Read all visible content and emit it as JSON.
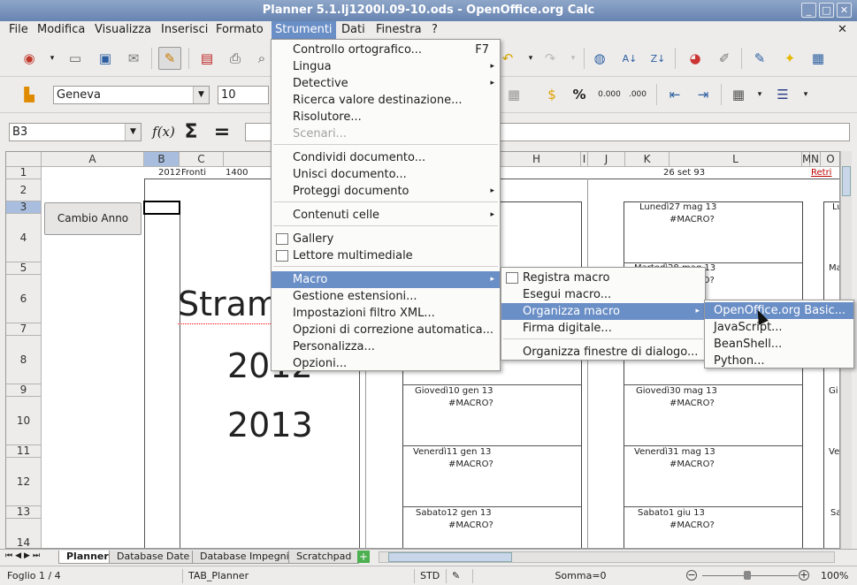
{
  "window": {
    "title": "Planner 5.1.lj1200l.09-10.ods - OpenOffice.org Calc"
  },
  "menubar": [
    "File",
    "Modifica",
    "Visualizza",
    "Inserisci",
    "Formato",
    "Strumenti",
    "Dati",
    "Finestra",
    "?"
  ],
  "formatting": {
    "font_name": "Geneva",
    "font_size": "10"
  },
  "formula_bar": {
    "cell_ref": "B3",
    "content": ""
  },
  "columns": [
    "A",
    "B",
    "C",
    "H",
    "I",
    "J",
    "K",
    "L",
    "M",
    "N",
    "O"
  ],
  "rows": [
    "1",
    "2",
    "3",
    "4",
    "5",
    "6",
    "7",
    "8",
    "9",
    "10",
    "11",
    "12",
    "13",
    "14"
  ],
  "cells": {
    "b1": "2012",
    "c1": "Fronti",
    "d1": "1400",
    "l1": "26 set 93",
    "o1": "Retri",
    "cambio_anno": "Cambio Anno",
    "stram": "Stram",
    "year1": "2012",
    "year2": "2013",
    "cal_left": [
      {
        "day": "Giovedì10 gen 13",
        "val": "#MACRO?"
      },
      {
        "day": "Venerdì11 gen 13",
        "val": "#MACRO?"
      },
      {
        "day": "Sabato12 gen 13",
        "val": "#MACRO?"
      }
    ],
    "cal_right": [
      {
        "day": "Lunedì27 mag 13",
        "val": "#MACRO?"
      },
      {
        "day": "Martedì28 mag 13",
        "val": "#MACRO?"
      },
      {
        "day": "Giovedì30 mag 13",
        "val": "#MACRO?"
      },
      {
        "day": "Venerdì31 mag 13",
        "val": "#MACRO?"
      },
      {
        "day": "Sabato1 giu 13",
        "val": "#MACRO?"
      }
    ],
    "edge": [
      "Lu",
      "Ma",
      "Gi",
      "Ve",
      "Sa"
    ]
  },
  "strumenti_menu": {
    "items": [
      {
        "label": "Controllo ortografico...",
        "shortcut": "F7"
      },
      {
        "label": "Lingua",
        "submenu": true
      },
      {
        "label": "Detective",
        "submenu": true
      },
      {
        "label": "Ricerca valore destinazione..."
      },
      {
        "label": "Risolutore..."
      },
      {
        "label": "Scenari...",
        "disabled": true
      },
      {
        "label": "Condividi documento..."
      },
      {
        "label": "Unisci documento..."
      },
      {
        "label": "Proteggi documento",
        "submenu": true
      },
      {
        "label": "Contenuti celle",
        "submenu": true
      },
      {
        "label": "Gallery",
        "checkbox": true
      },
      {
        "label": "Lettore multimediale",
        "checkbox": true
      },
      {
        "label": "Macro",
        "submenu": true,
        "highlighted": true
      },
      {
        "label": "Gestione estensioni..."
      },
      {
        "label": "Impostazioni filtro XML..."
      },
      {
        "label": "Opzioni di correzione automatica..."
      },
      {
        "label": "Personalizza..."
      },
      {
        "label": "Opzioni..."
      }
    ]
  },
  "macro_menu": {
    "items": [
      {
        "label": "Registra macro",
        "checkbox": true
      },
      {
        "label": "Esegui macro..."
      },
      {
        "label": "Organizza macro",
        "submenu": true,
        "highlighted": true
      },
      {
        "label": "Firma digitale..."
      },
      {
        "label": "Organizza finestre di dialogo..."
      }
    ]
  },
  "organizza_menu": {
    "items": [
      {
        "label": "OpenOffice.org Basic...",
        "highlighted": true
      },
      {
        "label": "JavaScript..."
      },
      {
        "label": "BeanShell..."
      },
      {
        "label": "Python..."
      }
    ]
  },
  "sheet_tabs": [
    "Planner",
    "Database Date",
    "Database Impegni",
    "Scratchpad"
  ],
  "status": {
    "sheet": "Foglio 1 / 4",
    "style": "TAB_Planner",
    "mode": "STD",
    "sum": "Somma=0",
    "zoom": "100%"
  },
  "colors": {
    "titlebar": "#7591bb",
    "highlight": "#6a8ec6",
    "selected_header": "#a9bedf"
  }
}
